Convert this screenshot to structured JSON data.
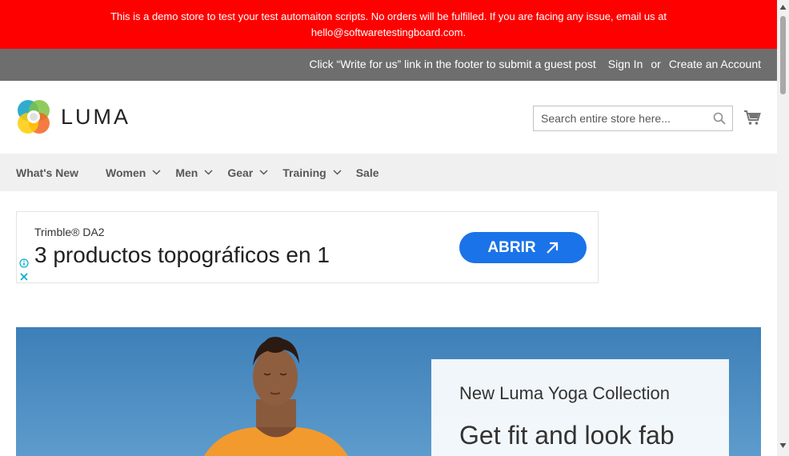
{
  "notice": {
    "line1": "This is a demo store to test your test automaiton scripts. No orders will be fulfilled. If you are facing any issue, email us at",
    "line2": "hello@softwaretestingboard.com."
  },
  "panel": {
    "write_for_us": "Click “Write for us” link in the footer to submit a guest post",
    "sign_in": "Sign In",
    "or": "or",
    "create_account": "Create an Account"
  },
  "logo": {
    "text": "LUMA"
  },
  "search": {
    "placeholder": "Search entire store here..."
  },
  "nav": {
    "items": [
      {
        "label": "What's New"
      },
      {
        "label": "Women"
      },
      {
        "label": "Men"
      },
      {
        "label": "Gear"
      },
      {
        "label": "Training"
      },
      {
        "label": "Sale"
      }
    ]
  },
  "ad": {
    "brand": "Trimble® DA2",
    "headline": "3 productos topográficos en 1",
    "cta": "ABRIR"
  },
  "hero": {
    "kicker": "New Luma Yoga Collection",
    "title": "Get fit and look fab"
  },
  "colors": {
    "notice_bg": "#ff0000",
    "panel_bg": "#6e6e6e",
    "nav_bg": "#f0f0f0",
    "ad_cta": "#1a73e8"
  }
}
